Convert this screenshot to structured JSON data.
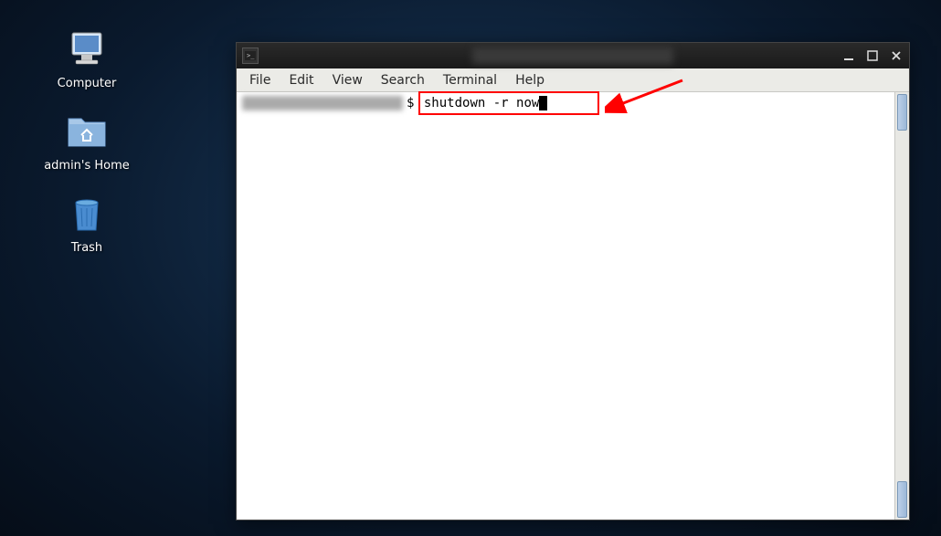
{
  "desktop": {
    "icons": {
      "computer": {
        "label": "Computer"
      },
      "home": {
        "label": "admin's Home"
      },
      "trash": {
        "label": "Trash"
      }
    }
  },
  "terminal": {
    "menubar": {
      "file": "File",
      "edit": "Edit",
      "view": "View",
      "search": "Search",
      "terminal": "Terminal",
      "help": "Help"
    },
    "prompt_symbol": "$",
    "command": "shutdown -r now"
  }
}
